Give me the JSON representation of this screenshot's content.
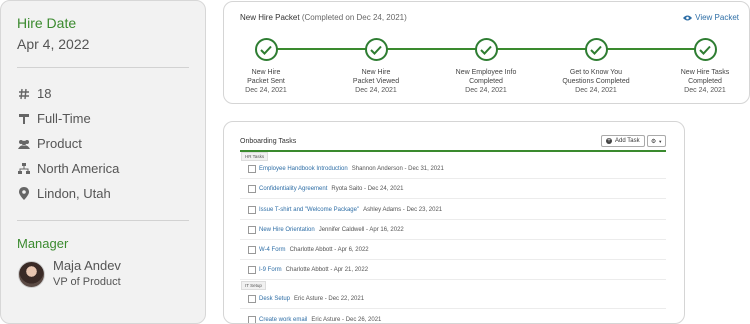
{
  "profile": {
    "hire_date_label": "Hire Date",
    "hire_date_value": "Apr 4, 2022",
    "employee_number": "18",
    "employment_type": "Full-Time",
    "department": "Product",
    "region": "North America",
    "location": "Lindon, Utah",
    "manager_label": "Manager",
    "manager_name": "Maja Andev",
    "manager_title": "VP of Product"
  },
  "packet": {
    "title": "New Hire Packet",
    "completed_note": "(Completed on Dec 24, 2021)",
    "view_link": "View Packet",
    "steps": [
      {
        "line1": "New Hire",
        "line2": "Packet Sent",
        "date": "Dec 24, 2021"
      },
      {
        "line1": "New Hire",
        "line2": "Packet Viewed",
        "date": "Dec 24, 2021"
      },
      {
        "line1": "New Employee Info",
        "line2": "Completed",
        "date": "Dec 24, 2021"
      },
      {
        "line1": "Get to Know You",
        "line2": "Questions Completed",
        "date": "Dec 24, 2021"
      },
      {
        "line1": "New Hire Tasks",
        "line2": "Completed",
        "date": "Dec 24, 2021"
      }
    ]
  },
  "tasks": {
    "title": "Onboarding Tasks",
    "add_task_label": "Add Task",
    "groups": [
      {
        "name": "HR Tasks",
        "items": [
          {
            "name": "Employee Handbook Introduction",
            "meta": "Shannon Anderson - Dec 31, 2021"
          },
          {
            "name": "Confidentiality Agreement",
            "meta": "Ryota Saito - Dec 24, 2021"
          },
          {
            "name": "Issue T-shirt and \"Welcome Package\"",
            "meta": "Ashley Adams - Dec 23, 2021"
          },
          {
            "name": "New Hire Orientation",
            "meta": "Jennifer Caldwell - Apr 16, 2022"
          },
          {
            "name": "W-4 Form",
            "meta": "Charlotte Abbott - Apr 6, 2022"
          },
          {
            "name": "I-9 Form",
            "meta": "Charlotte Abbott - Apr 21, 2022"
          }
        ]
      },
      {
        "name": "IT Setup",
        "items": [
          {
            "name": "Desk Setup",
            "meta": "Eric Asture - Dec 22, 2021"
          },
          {
            "name": "Create work email",
            "meta": "Eric Asture - Dec 26, 2021"
          }
        ]
      }
    ]
  },
  "colors": {
    "accent_green": "#3a8a2e",
    "link_blue": "#2e6ea6"
  }
}
